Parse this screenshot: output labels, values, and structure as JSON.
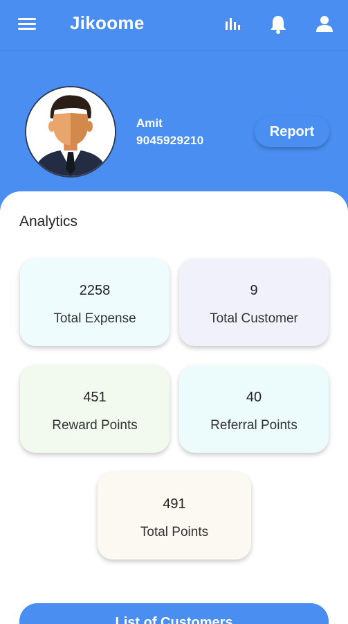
{
  "app": {
    "title": "Jikoome"
  },
  "appbar": {
    "menu_icon": "menu-icon",
    "chart_icon": "bar-chart-icon",
    "bell_icon": "bell-icon",
    "profile_icon": "person-icon"
  },
  "profile": {
    "name": "Amit",
    "phone": "9045929210",
    "report_label": "Report"
  },
  "analytics": {
    "title": "Analytics",
    "cards": [
      {
        "value": "2258",
        "label": "Total Expense",
        "color": "#eefcfd"
      },
      {
        "value": "9",
        "label": "Total Customer",
        "color": "#f1f1fb"
      },
      {
        "value": "451",
        "label": "Reward Points",
        "color": "#f2faf0"
      },
      {
        "value": "40",
        "label": "Referral Points",
        "color": "#ecfbfb"
      },
      {
        "value": "491",
        "label": "Total Points",
        "color": "#fcf8f2"
      }
    ]
  },
  "bottom_button": {
    "label": "List of Customers"
  },
  "colors": {
    "primary": "#4a8ef2",
    "panel": "#ffffff"
  }
}
